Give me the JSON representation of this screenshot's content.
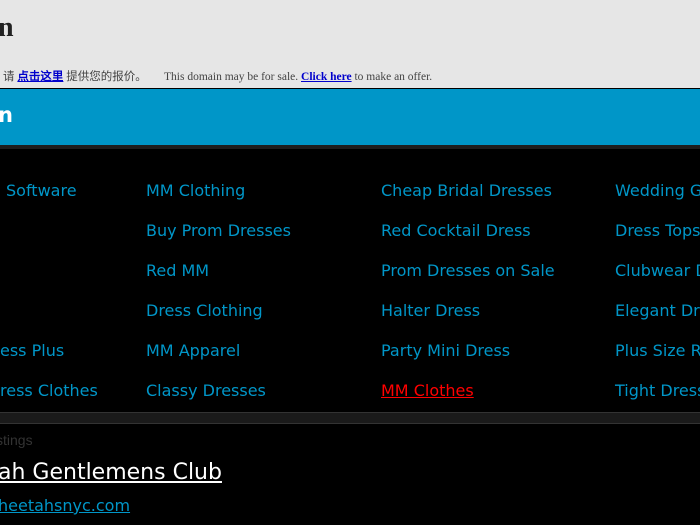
{
  "header": {
    "title": "n",
    "notice_cn_prefix": "请",
    "notice_cn_link": "点击这里",
    "notice_cn_suffix": "提供您的报价。",
    "notice_en_prefix": "This domain may be for sale.",
    "notice_en_link": "Click here",
    "notice_en_suffix": "to make an offer."
  },
  "banner": {
    "title": "n"
  },
  "links": {
    "col1": [
      "Software",
      "",
      "",
      "",
      "ess Plus",
      "ress Clothes"
    ],
    "col2": [
      "MM Clothing",
      "Buy Prom Dresses",
      "Red MM",
      "Dress Clothing",
      "MM Apparel",
      "Classy Dresses"
    ],
    "col3": [
      "Cheap Bridal Dresses",
      "Red Cocktail Dress",
      "Prom Dresses on Sale",
      "Halter Dress",
      "Party Mini Dress",
      "MM Clothes"
    ],
    "col4": [
      "Wedding G",
      "Dress Tops",
      "Clubwear D",
      "Elegant Dr",
      "Plus Size R",
      "Tight Dress"
    ]
  },
  "colors": {
    "accent": "#0096c8",
    "active_link": "#ff0000",
    "header_bg": "#e6e6e6"
  },
  "listings": {
    "label": "stings",
    "result_title": "ah Gentlemens Club",
    "result_url": "heetahsnyc.com"
  }
}
